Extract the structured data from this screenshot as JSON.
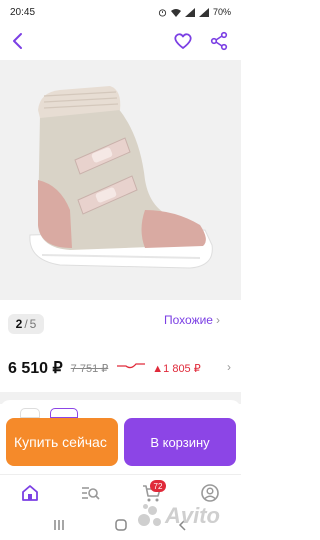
{
  "status_bar": {
    "time": "20:45",
    "battery": "70%"
  },
  "top_bar": {
    "icons": [
      "back-arrow-icon",
      "heart-icon",
      "share-icon"
    ]
  },
  "gallery": {
    "current": "2",
    "separator": "/",
    "total": "5"
  },
  "similar": {
    "label": "Похожие",
    "chevron": "›"
  },
  "price": {
    "current": "6 510 ₽",
    "old": "7 751 ₽",
    "difference": "▲1 805 ₽",
    "chevron": "›",
    "colors": {
      "trend": "#e02a3a"
    }
  },
  "actions": {
    "buy_now": "Купить сейчас",
    "add_to_cart": "В корзину",
    "colors": {
      "buy_now": "#f58a2a",
      "add_to_cart": "#8c45e6"
    }
  },
  "bottom_nav": {
    "items": [
      "home-icon",
      "search-icon",
      "cart-icon",
      "profile-icon"
    ],
    "cart_badge": "72"
  },
  "watermark": {
    "brand": "Avito"
  },
  "colors": {
    "accent": "#7b3fe4"
  }
}
